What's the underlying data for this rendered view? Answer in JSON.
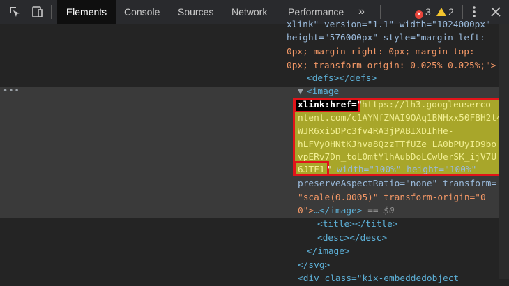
{
  "toolbar": {
    "tabs": [
      "Elements",
      "Console",
      "Sources",
      "Network",
      "Performance"
    ],
    "active_tab": "Elements",
    "more_label": "»",
    "error_count": "3",
    "warning_count": "2"
  },
  "code": {
    "line_top": "xlink\" version=\"1.1\" width=\"1024000px\"",
    "line_height_attr": "height=\"576000px\" style=\"margin-left:",
    "line_margin": "0px; margin-right: 0px; margin-top:",
    "line_transform": "0px; transform-origin: 0.025% 0.025%;\">",
    "defs": "<defs></defs>",
    "image_open": "<image",
    "xlink_attr": "xlink:href=",
    "quote_open": "\"",
    "url_lines": [
      "https://lh3.googleuserco",
      "ntent.com/c1AYNfZNAI9OAq1BNHxx50FBH2t4",
      "WJR6xi5DPc3fv4RA3jPABIXDIhHe-",
      "hLFVyOHNtKJhva8QzzTTfUZe_LA0bPUyID9bo",
      "vpERv7Dn_toL0mtYlhAubDoLCwUerSK_ijV7U",
      "6JTF1"
    ],
    "quote_close": "\"",
    "after_url": "width=\"100%\" height=\"100%\"",
    "preserve": "preserveAspectRatio=\"none\" transform=",
    "scale": "\"scale(0.0005)\" transform-origin=\"0",
    "close_image_prefix": "0\">",
    "close_image_tag": "…</image>",
    "selected_marker": "== $0",
    "title": "<title></title>",
    "desc": "<desc></desc>",
    "image_close": "</image>",
    "svg_close": "</svg>",
    "bottom_partial": "<div class=\"kix-embeddedobject"
  },
  "colors": {
    "tag": "#5db0d7",
    "attr": "#9bbbdc",
    "value": "#f29766",
    "highlight": "#a8a62a",
    "box": "#e1141a"
  }
}
